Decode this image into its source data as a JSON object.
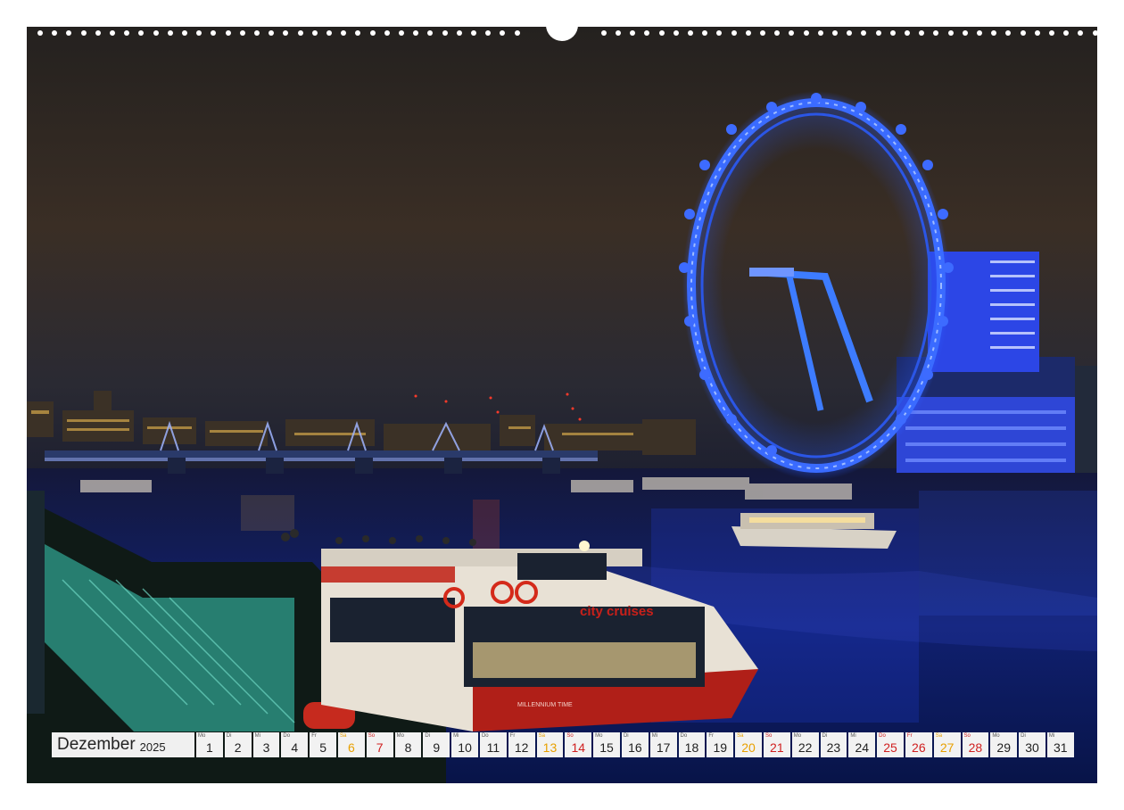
{
  "calendar": {
    "month": "Dezember",
    "year": "2025",
    "days": [
      {
        "wd": "Mo",
        "d": "1",
        "t": "weekday"
      },
      {
        "wd": "Di",
        "d": "2",
        "t": "weekday"
      },
      {
        "wd": "Mi",
        "d": "3",
        "t": "weekday"
      },
      {
        "wd": "Do",
        "d": "4",
        "t": "weekday"
      },
      {
        "wd": "Fr",
        "d": "5",
        "t": "weekday"
      },
      {
        "wd": "Sa",
        "d": "6",
        "t": "sat"
      },
      {
        "wd": "So",
        "d": "7",
        "t": "sun"
      },
      {
        "wd": "Mo",
        "d": "8",
        "t": "weekday"
      },
      {
        "wd": "Di",
        "d": "9",
        "t": "weekday"
      },
      {
        "wd": "Mi",
        "d": "10",
        "t": "weekday"
      },
      {
        "wd": "Do",
        "d": "11",
        "t": "weekday"
      },
      {
        "wd": "Fr",
        "d": "12",
        "t": "weekday"
      },
      {
        "wd": "Sa",
        "d": "13",
        "t": "sat"
      },
      {
        "wd": "So",
        "d": "14",
        "t": "sun"
      },
      {
        "wd": "Mo",
        "d": "15",
        "t": "weekday"
      },
      {
        "wd": "Di",
        "d": "16",
        "t": "weekday"
      },
      {
        "wd": "Mi",
        "d": "17",
        "t": "weekday"
      },
      {
        "wd": "Do",
        "d": "18",
        "t": "weekday"
      },
      {
        "wd": "Fr",
        "d": "19",
        "t": "weekday"
      },
      {
        "wd": "Sa",
        "d": "20",
        "t": "sat"
      },
      {
        "wd": "So",
        "d": "21",
        "t": "sun"
      },
      {
        "wd": "Mo",
        "d": "22",
        "t": "weekday"
      },
      {
        "wd": "Di",
        "d": "23",
        "t": "weekday"
      },
      {
        "wd": "Mi",
        "d": "24",
        "t": "weekday"
      },
      {
        "wd": "Do",
        "d": "25",
        "t": "sun"
      },
      {
        "wd": "Fr",
        "d": "26",
        "t": "sun"
      },
      {
        "wd": "Sa",
        "d": "27",
        "t": "sat"
      },
      {
        "wd": "So",
        "d": "28",
        "t": "sun"
      },
      {
        "wd": "Mo",
        "d": "29",
        "t": "weekday"
      },
      {
        "wd": "Di",
        "d": "30",
        "t": "weekday"
      },
      {
        "wd": "Mi",
        "d": "31",
        "t": "weekday"
      }
    ]
  },
  "photo": {
    "boat_brand": "city cruises",
    "boat_name": "MILLENNIUM TIME"
  },
  "colors": {
    "wheel": "#2f6bff",
    "river": "#0d1d6e",
    "sky_top": "#2a2622",
    "sky_bottom": "#3b2f25"
  }
}
